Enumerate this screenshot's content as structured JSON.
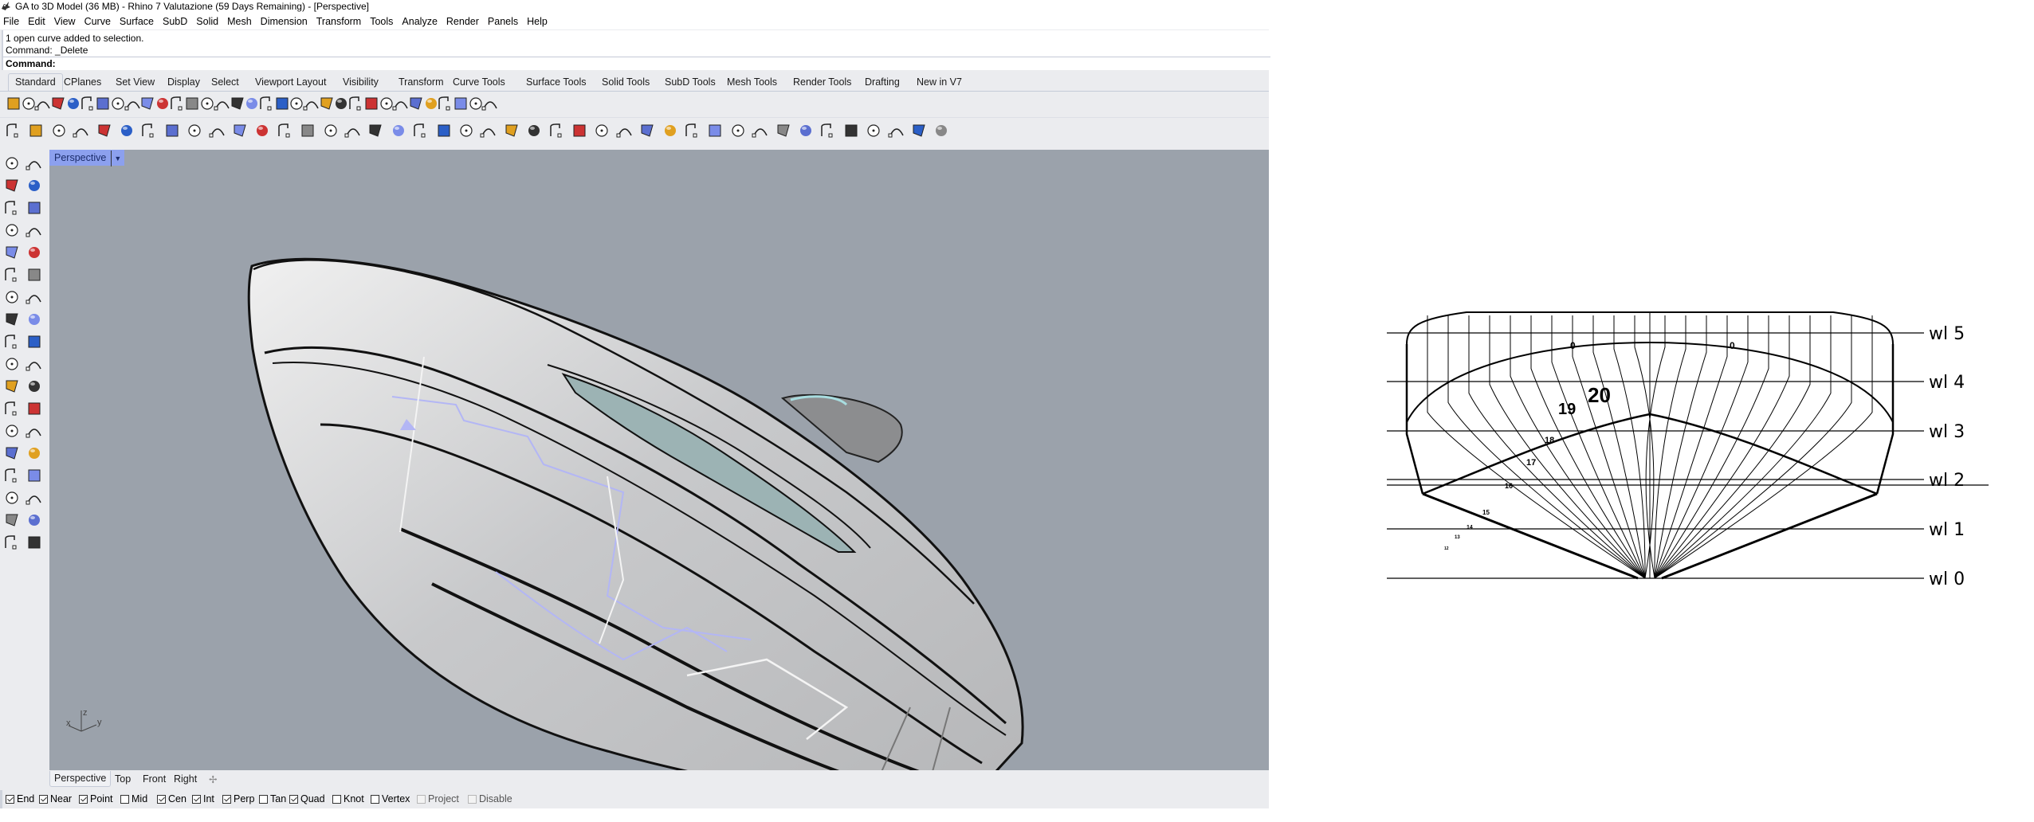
{
  "window": {
    "title": "GA to 3D Model (36 MB) - Rhino 7 Valutazione (59 Days Remaining) - [Perspective]",
    "app_icon": "rhino-logo-icon"
  },
  "menu": [
    "File",
    "Edit",
    "View",
    "Curve",
    "Surface",
    "SubD",
    "Solid",
    "Mesh",
    "Dimension",
    "Transform",
    "Tools",
    "Analyze",
    "Render",
    "Panels",
    "Help"
  ],
  "command_history": {
    "line1": "1 open curve added to selection.",
    "line2": "Command: _Delete",
    "prompt": "Command:"
  },
  "toolbar_tabs": [
    "Standard",
    "CPlanes",
    "Set View",
    "Display",
    "Select",
    "Viewport Layout",
    "Visibility",
    "Transform",
    "Curve Tools",
    "Surface Tools",
    "Solid Tools",
    "SubD Tools",
    "Mesh Tools",
    "Render Tools",
    "Drafting",
    "New in V7"
  ],
  "active_toolbar_tab": "Standard",
  "standard_toolbar_icons": [
    "new-icon",
    "open-icon",
    "save-icon",
    "print-icon",
    "import-icon",
    "cut-icon",
    "copy-icon",
    "paste-icon",
    "undo-icon",
    "pan-icon",
    "rotate-view-icon",
    "zoom-dynamic-icon",
    "zoom-window-icon",
    "zoom-extents-icon",
    "zoom-selected-icon",
    "undo-view-icon",
    "four-viewports-icon",
    "car-icon",
    "grid-snap-icon",
    "osnap-icon",
    "show-objects-icon",
    "light-icon",
    "lock-icon",
    "layer-icon",
    "color-wheel-icon",
    "shaded-sphere-icon",
    "ghosted-sphere-icon",
    "rendered-sphere-icon",
    "render-icon",
    "options-gear-icon",
    "dimension-icon",
    "analysis-icon",
    "help-icon"
  ],
  "curve_tools_icons": [
    "fillet-curves-icon",
    "chamfer-curves-icon",
    "trim-icon",
    "blend-curve-icon",
    "match-curve-icon",
    "adjustable-blend-icon",
    "polyline-icon",
    "arc-profile-icon",
    "offset-curve-icon",
    "curve-fillet-icon",
    "point-edit-icon",
    "crv-deformation-icon",
    "flatten-icon",
    "dash-line-icon",
    "rebuild-icon",
    "refit-icon",
    "curve-flow-icon",
    "cylinder-icon",
    "walk-icon",
    "walk-set-icon",
    "fit-icon",
    "degree-icon",
    "fair-icon",
    "control-points-icon",
    "insert-knot-icon",
    "polygon-icon",
    "circle-points-icon",
    "add-point-icon",
    "edit-points-icon",
    "delete-point-icon",
    "insert-point-icon",
    "extend-icon",
    "connect-icon",
    "arc-icon",
    "offset-icon",
    "region-icon",
    "project-icon",
    "curve-smooth-icon",
    "line-magenta-icon",
    "blend-surfaces-icon",
    "align-icon",
    "ring-icon"
  ],
  "left_toolbar_icons": [
    "select-icon",
    "point-icon",
    "polyline-icon",
    "curve-icon",
    "circle-icon",
    "ellipse-icon",
    "arc-icon",
    "rectangle-icon",
    "polygon-icon",
    "fillet-icon",
    "surface-from-points-icon",
    "extrude-surface-icon",
    "box-icon",
    "boolean-spheres-icon",
    "revolve-icon",
    "patch-icon",
    "group-icon",
    "explode-icon",
    "trim-icon",
    "split-icon",
    "layer-state-icon",
    "display-icon",
    "curve-edit-icon",
    "offset-icon",
    "text-icon",
    "scale-icon",
    "array-icon",
    "move-icon",
    "solid-icon",
    "extrude-icon",
    "grid-icon",
    "dimension-icon",
    "mirror-icon",
    "check-icon",
    "mesh-icon",
    "render-icon"
  ],
  "viewport": {
    "title": "Perspective",
    "axes": {
      "x": "x",
      "y": "y",
      "z": "z"
    },
    "background_color": "#9ba2ab",
    "model": "yacht-hull"
  },
  "viewport_tabs": [
    "Perspective",
    "Top",
    "Front",
    "Right"
  ],
  "active_viewport_tab": "Perspective",
  "osnaps": [
    {
      "label": "End",
      "checked": true,
      "enabled": true
    },
    {
      "label": "Near",
      "checked": true,
      "enabled": true
    },
    {
      "label": "Point",
      "checked": true,
      "enabled": true
    },
    {
      "label": "Mid",
      "checked": false,
      "enabled": true
    },
    {
      "label": "Cen",
      "checked": true,
      "enabled": true
    },
    {
      "label": "Int",
      "checked": true,
      "enabled": true
    },
    {
      "label": "Perp",
      "checked": true,
      "enabled": true
    },
    {
      "label": "Tan",
      "checked": false,
      "enabled": true
    },
    {
      "label": "Quad",
      "checked": true,
      "enabled": true
    },
    {
      "label": "Knot",
      "checked": false,
      "enabled": true
    },
    {
      "label": "Vertex",
      "checked": false,
      "enabled": true
    },
    {
      "label": "Project",
      "checked": false,
      "enabled": false
    },
    {
      "label": "Disable",
      "checked": false,
      "enabled": false
    }
  ],
  "body_plan": {
    "waterlines": [
      "wl 5",
      "wl 4",
      "wl 3",
      "wl 2",
      "wl 1",
      "wl 0"
    ],
    "station_labels_large": [
      "20",
      "19"
    ],
    "station_labels_small": [
      "18",
      "17",
      "16",
      "15",
      "14",
      "13",
      "12"
    ],
    "top_labels": [
      "0",
      "0"
    ]
  }
}
